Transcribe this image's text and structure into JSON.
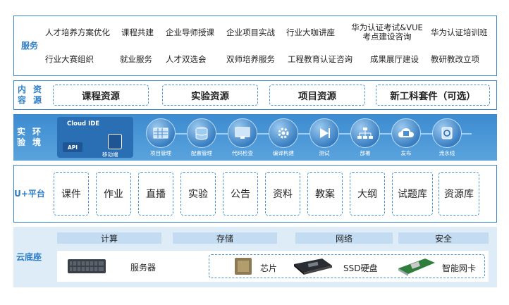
{
  "services": {
    "label": "服务",
    "row1": [
      "人才培养方案优化",
      "课程共建",
      "企业导师授课",
      "企业项目实战",
      "行业大咖讲座",
      "华为认证考试&VUE",
      "考点建设咨询",
      "华为认证培训班"
    ],
    "row2": [
      "行业大赛组织",
      "就业服务",
      "人才双选会",
      "双师培养服务",
      "工程教育认证咨询",
      "成果展厅建设",
      "教研教改立项"
    ]
  },
  "content": {
    "label_line1": "内容",
    "label_line2": "资源",
    "items": [
      "课程资源",
      "实验资源",
      "项目资源",
      "新工科套件（可选）"
    ]
  },
  "environment": {
    "label_line1": "实验",
    "label_line2": "环境",
    "ide_title": "Cloud IDE",
    "api_label": "API",
    "mobile_label": "移动端",
    "nodes": [
      "项目管理",
      "配置管理",
      "代码检查",
      "编译构建",
      "测试",
      "部署",
      "发布",
      "流水线"
    ]
  },
  "uplus": {
    "label_line1": "U+",
    "label_line2": "平台",
    "items": [
      "课件",
      "作业",
      "直播",
      "实验",
      "公告",
      "资料",
      "教案",
      "大纲",
      "试题库",
      "资源库"
    ]
  },
  "cloud": {
    "label": "云底座",
    "bars": [
      "计算",
      "存储",
      "网络",
      "安全"
    ],
    "server_label": "服务器",
    "chip_label": "芯片",
    "ssd_label": "SSD硬盘",
    "nic_label": "智能网卡"
  },
  "colors": {
    "accent": "#3a86c8",
    "env_band": "#4a96d6",
    "cloud_band": "#deecf8"
  }
}
